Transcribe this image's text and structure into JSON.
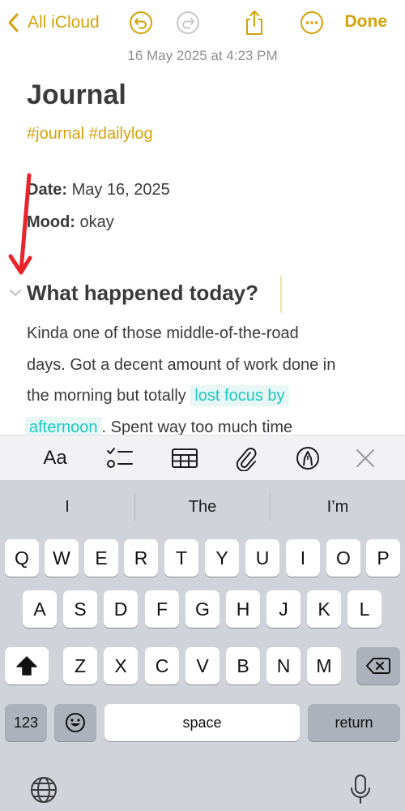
{
  "nav": {
    "back_label": "All iCloud",
    "done_label": "Done"
  },
  "timestamp": "16 May 2025 at 4:23 PM",
  "note": {
    "title": "Journal",
    "tags": "#journal #dailylog",
    "date_label": "Date:",
    "date_value": " May 16, 2025",
    "mood_label": "Mood:",
    "mood_value": " okay",
    "section_heading": "What happened today?",
    "para_line1": "Kinda one of those middle-of-the-road",
    "para_line2": "days. Got a decent amount of work done in",
    "para_line3_pre": "the morning but totally ",
    "para_highlight_1": "lost focus by",
    "para_highlight_2": "afternoon",
    "para_line4_post": ". Spent way too much time"
  },
  "format_toolbar": {
    "text_style_label": "Aa"
  },
  "keyboard": {
    "suggestions": [
      "I",
      "The",
      "I’m"
    ],
    "row1": [
      "Q",
      "W",
      "E",
      "R",
      "T",
      "Y",
      "U",
      "I",
      "O",
      "P"
    ],
    "row2": [
      "A",
      "S",
      "D",
      "F",
      "G",
      "H",
      "J",
      "K",
      "L"
    ],
    "row3": [
      "Z",
      "X",
      "C",
      "V",
      "B",
      "N",
      "M"
    ],
    "numbers_label": "123",
    "space_label": "space",
    "return_label": "return"
  },
  "colors": {
    "accent": "#d4a20a",
    "highlight_text": "#1ec7c2",
    "highlight_bg": "#e6f7f6",
    "annotation_arrow": "#e8232a"
  }
}
